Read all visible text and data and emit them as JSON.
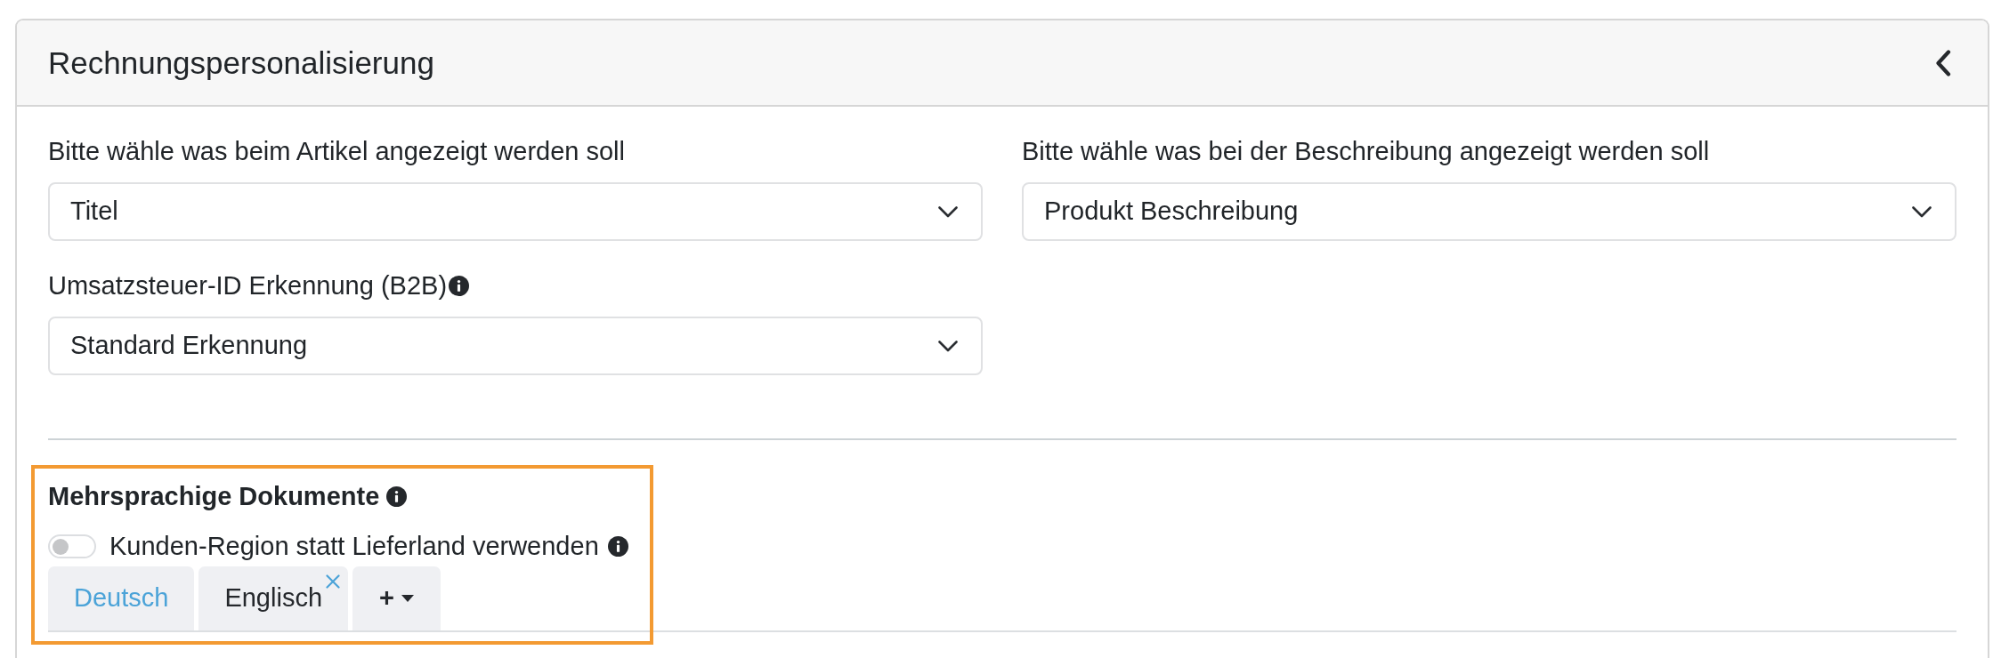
{
  "panel": {
    "title": "Rechnungspersonalisierung",
    "collapsed": false
  },
  "fields": [
    {
      "label": "Bitte wähle was beim Artikel angezeigt werden soll",
      "value": "Titel",
      "has_info": false
    },
    {
      "label": "Bitte wähle was bei der Beschreibung angezeigt werden soll",
      "value": "Produkt Beschreibung",
      "has_info": false
    },
    {
      "label": "Umsatzsteuer-ID Erkennung (B2B)",
      "value": "Standard Erkennung",
      "has_info": true
    }
  ],
  "multilingual": {
    "title": "Mehrsprachige Dokumente",
    "has_info": true,
    "highlighted": true,
    "toggle": {
      "label": "Kunden-Region statt Lieferland verwenden",
      "on": false,
      "has_info": true
    },
    "tabs": [
      {
        "kind": "language",
        "label": "Deutsch",
        "selected": true,
        "closable": false
      },
      {
        "kind": "language",
        "label": "Englisch",
        "selected": false,
        "closable": true
      },
      {
        "kind": "add",
        "label": "+",
        "selected": false
      }
    ]
  }
}
